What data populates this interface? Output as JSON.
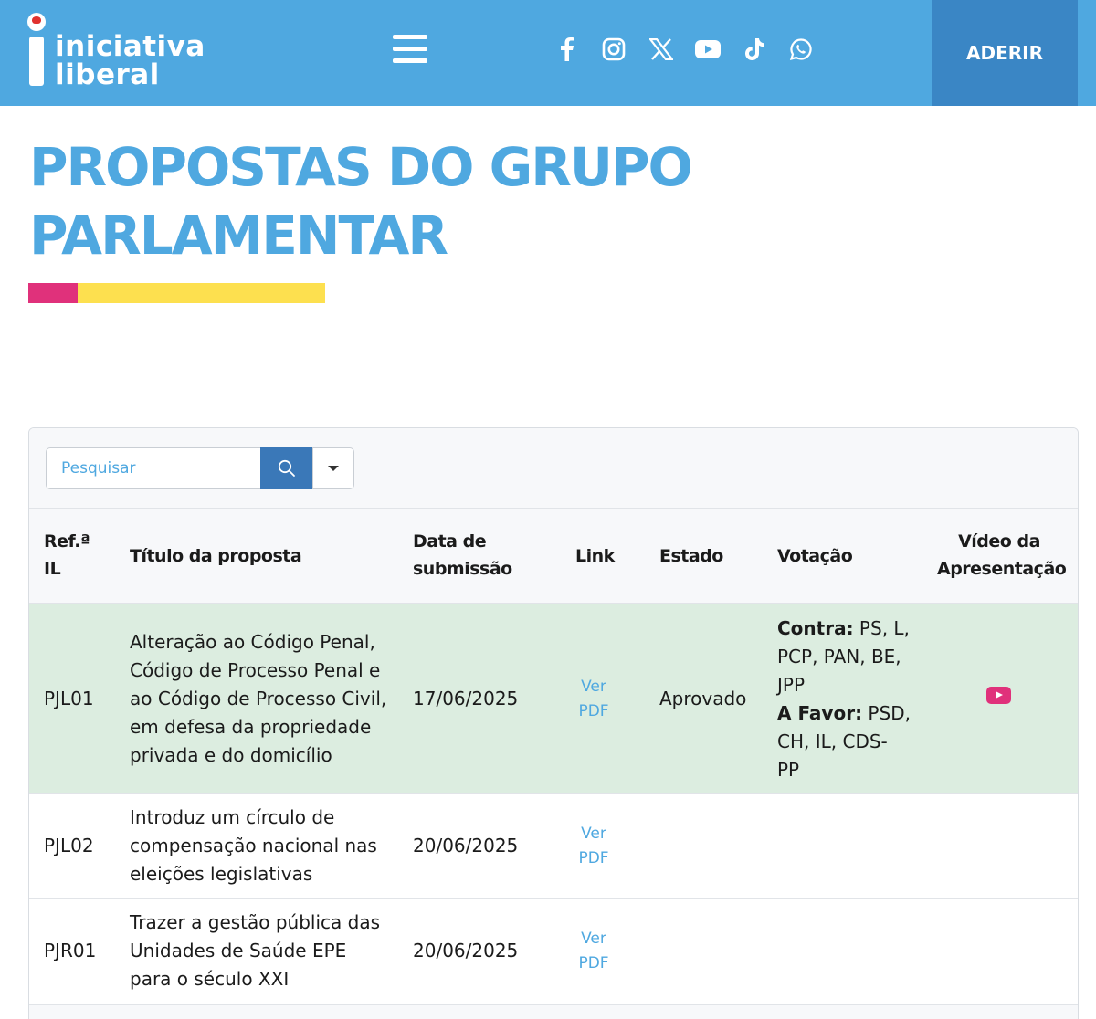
{
  "header": {
    "logo_line1": "iniciativa",
    "logo_line2": "liberal",
    "social_icons": [
      "facebook-icon",
      "instagram-icon",
      "x-icon",
      "youtube-icon",
      "tiktok-icon",
      "whatsapp-icon"
    ],
    "cta_label": "ADERIR"
  },
  "page": {
    "title_line1": "PROPOSTAS DO GRUPO",
    "title_line2": "PARLAMENTAR"
  },
  "toolbar": {
    "search_placeholder": "Pesquisar"
  },
  "table": {
    "headers": {
      "ref_line1": "Ref.ª",
      "ref_line2": "IL",
      "titulo": "Título da proposta",
      "data_line1": "Data de",
      "data_line2": "submissão",
      "link": "Link",
      "estado": "Estado",
      "votacao": "Votação",
      "video_line1": "Vídeo da",
      "video_line2": "Apresentação"
    },
    "rows": [
      {
        "ref": "PJL01",
        "titulo": [
          "Alteração ao Código Penal,",
          "Código de Processo Penal e",
          "ao Código de Processo Civil,",
          "em defesa da propriedade",
          "privada e do domicílio"
        ],
        "data": "17/06/2025",
        "link_line1": "Ver",
        "link_line2": "PDF",
        "estado": "Aprovado",
        "contra_label": "Contra:",
        "contra_l1": " PS, L,",
        "contra_l2": "PCP, PAN, BE,",
        "contra_l3": "JPP",
        "favor_label": "A Favor:",
        "favor_l1": " PSD,",
        "favor_l2": "CH, IL, CDS-",
        "favor_l3": "PP"
      },
      {
        "ref": "PJL02",
        "titulo": [
          "Introduz um círculo de",
          "compensação nacional nas",
          "eleições legislativas"
        ],
        "data": "20/06/2025",
        "link_line1": "Ver",
        "link_line2": "PDF"
      },
      {
        "ref": "PJR01",
        "titulo": [
          "Trazer a gestão pública das",
          "Unidades de Saúde EPE",
          "para o século XXI"
        ],
        "data": "20/06/2025",
        "link_line1": "Ver",
        "link_line2": "PDF"
      }
    ]
  },
  "colors": {
    "brand_blue": "#4fa8e0",
    "cta_blue": "#3a86c5",
    "accent_pink": "#e0317b",
    "accent_yellow": "#fde04f",
    "approved_row": "#dcede0"
  }
}
